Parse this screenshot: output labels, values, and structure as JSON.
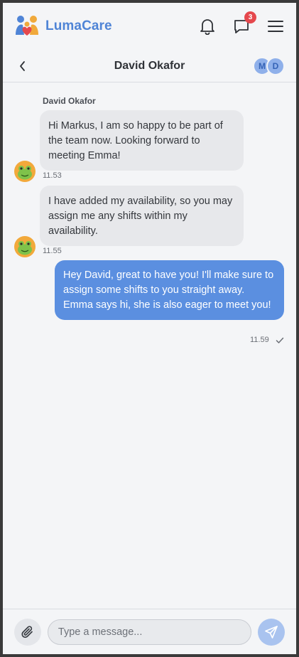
{
  "app": {
    "brand": "LumaCare",
    "colors": {
      "brand": "#4f84d6",
      "badge": "#e5484d",
      "outgoing_bubble": "#5b8fe0",
      "incoming_bubble": "#e7e8eb"
    },
    "icons": {
      "logo": "family-heart-logo",
      "notifications": "bell-icon",
      "messages": "chat-bubble-icon",
      "menu": "hamburger-menu-icon"
    },
    "messages_badge": "3"
  },
  "conversation": {
    "title": "David Okafor",
    "participants": [
      {
        "initial": "M"
      },
      {
        "initial": "D"
      }
    ],
    "sender_label": "David Okafor",
    "messages": [
      {
        "direction": "in",
        "text": "Hi Markus, I am so happy to be part of the team now. Looking forward to meeting Emma!",
        "time": "11.53",
        "avatar": "frog-avatar"
      },
      {
        "direction": "in",
        "text": "I have added my availability, so you may assign me any shifts within my availability.",
        "time": "11.55",
        "avatar": "frog-avatar"
      },
      {
        "direction": "out",
        "text": "Hey David, great to have you! I'll make sure to assign some shifts to you straight away. Emma says hi, she is also eager to meet you!",
        "time": "11.59",
        "status_icon": "check-icon"
      }
    ]
  },
  "composer": {
    "placeholder": "Type a message...",
    "value": "",
    "icons": {
      "attach": "paperclip-icon",
      "send": "send-icon"
    }
  }
}
